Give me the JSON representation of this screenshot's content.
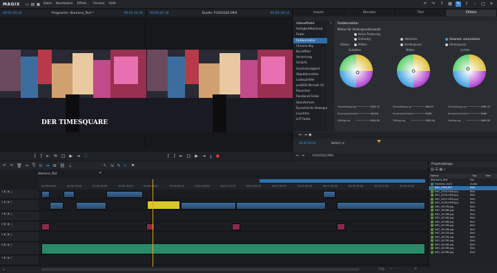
{
  "app": {
    "logo": "MAGIX",
    "menu": [
      "Datei",
      "Bearbeiten",
      "Effekt...",
      "Fenster",
      "Hilfe"
    ]
  },
  "program_monitor": {
    "tc_left": "00:00:59:14",
    "title": "Programm: dkamera_Test *",
    "tc_right": "00:02:26:26",
    "overlay_text": "DER TIMESQUARE",
    "scrub_time": "00:00:59:14"
  },
  "source_monitor": {
    "tc_left": "00:00:03:18",
    "title": "Quelle: P1050185.MP4",
    "tc_right": "00:00:18:14",
    "scrub_time": "00:16"
  },
  "right_panel": {
    "tabs": [
      "Import",
      "Blenden",
      "Titel",
      "Effekte"
    ],
    "active_tab": "Effekte",
    "category_header": "Videoeffekte",
    "categories": [
      "Videoeffekte",
      "Helligkeit/Kontrast",
      "Farbe",
      "Farbkorrektur",
      "Chroma Key",
      "Kunstfilter",
      "Verzerrung",
      "Schärfe",
      "Geschwindigkeit",
      "Objektkorrektur",
      "Lookupbilder",
      "proDAD Mercalli V2",
      "Rauschen",
      "Rendered Farbe",
      "Stanzformen",
      "Dynamische Bewegung",
      "Leuchten",
      "LUT-Farbe"
    ],
    "selected_category": "Farbkorrektur",
    "effect_title": "Farbkorrektur",
    "mode_label": "Modus für Vordergrundauswahl",
    "modes": [
      "Keine Änderung",
      "Einfarbig",
      "Abziehen",
      "Automat. vorzurücken"
    ],
    "mode_selected": "Automat. vorzurücken",
    "targets": [
      "Mitten",
      "Vordergrund",
      "Hintergrund"
    ],
    "target_label": "Stärke",
    "wheels": [
      {
        "label": "Schatten",
        "sat_label": "Farbsättigung",
        "sat_value": "212,37",
        "brightness_label": "Kontrastlichkeit",
        "brightness_value": "10,26",
        "gain_label": "Sättigung",
        "gain_value": "110,00"
      },
      {
        "label": "Mitten",
        "sat_label": "Farbsättigung",
        "sat_value": "45,33",
        "brightness_label": "Kontrastlichkeit",
        "brightness_value": "0,00",
        "gain_label": "Sättigung",
        "gain_value": "110,00"
      },
      {
        "label": "Lichter",
        "sat_label": "Farbsättigung",
        "sat_value": "178,37",
        "brightness_label": "Kontrastlichkeit",
        "brightness_value": "0,00",
        "gain_label": "Sättigung",
        "gain_value": "110,00"
      }
    ],
    "keyframe_label": "Befehl: rc",
    "keyframe_time": "00:00:59:14",
    "bottom_time": "P1050185.MP4"
  },
  "timeline": {
    "project_tab": "dkamera_Test",
    "ruler_marks": [
      "00:00:00:00",
      "00:00:10:00",
      "00:00:20:00",
      "00:00:30:00",
      "00:00:40:00",
      "00:00:50:00",
      "00:01:00:00",
      "00:01:10:00",
      "00:01:20:00",
      "00:01:30:00",
      "00:01:40:00",
      "00:01:50:00",
      "00:02:00:00",
      "00:02:10:00",
      "00:02:20:00"
    ],
    "zoom_label": "77%",
    "track_labels": [
      "1",
      "2",
      "3",
      "4",
      "5",
      "6",
      "7"
    ]
  },
  "project_panel": {
    "title": "Projektablage",
    "columns": [
      "Name",
      "Typ",
      "Bes"
    ],
    "items": [
      {
        "name": "dkamera_Test",
        "type": "Fav"
      },
      {
        "name": "Fanfare1.mp3",
        "type": "Audio"
      },
      {
        "name": "IMG_1965.JPG",
        "type": "Bild"
      },
      {
        "name": "IMG_2205-HDR.jpg",
        "type": "Bild"
      },
      {
        "name": "IMG_2206-HDR.jpg",
        "type": "Bild"
      },
      {
        "name": "IMG_2207-HDR.jpg",
        "type": "Bild"
      },
      {
        "name": "IMG_2208-HDR.jpg",
        "type": "Bild"
      },
      {
        "name": "IMG_3907B.jpg",
        "type": "Bild"
      },
      {
        "name": "IMG_3908B.jpg",
        "type": "Bild"
      },
      {
        "name": "IMG_4013B.jpg",
        "type": "Bild"
      },
      {
        "name": "IMG_4016B.jpg",
        "type": "Bild"
      },
      {
        "name": "IMG_4018B.jpg",
        "type": "Bild"
      },
      {
        "name": "IMG_4019B.jpg",
        "type": "Bild"
      },
      {
        "name": "IMG_4020B.jpg",
        "type": "Bild"
      },
      {
        "name": "IMG_4021B.jpg",
        "type": "Bild"
      },
      {
        "name": "IMG_4022B.jpg",
        "type": "Bild"
      },
      {
        "name": "IMG_4023B.jpg",
        "type": "Bild"
      },
      {
        "name": "IMG_4024B.jpg",
        "type": "Bild"
      },
      {
        "name": "IMG_4025B.jpg",
        "type": "Bild"
      },
      {
        "name": "IMG_4026B.jpg",
        "type": "Bild"
      }
    ],
    "selected_index": 2
  },
  "colors": {
    "accent": "#3b9dea",
    "selection": "#2f6fad",
    "audio_clip": "#2a8a6a",
    "playhead": "#e0a030"
  }
}
